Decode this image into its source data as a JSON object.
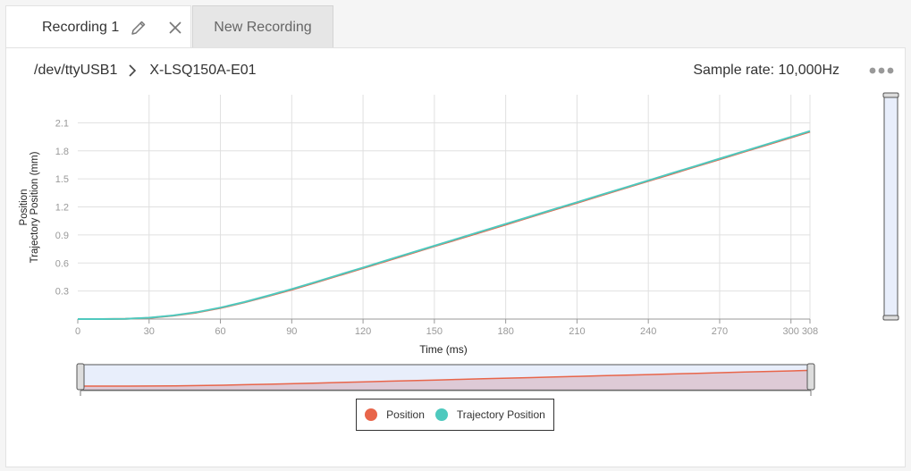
{
  "tabs": [
    {
      "label": "Recording 1",
      "active": true
    },
    {
      "label": "New Recording",
      "active": false
    }
  ],
  "breadcrumb": {
    "port": "/dev/ttyUSB1",
    "device": "X-LSQ150A-E01"
  },
  "sample_rate": "Sample rate: 10,000Hz",
  "colors": {
    "position": "#e8654a",
    "trajectory": "#4ec9be",
    "navigator_fill": "#e8eefb"
  },
  "chart_data": {
    "type": "line",
    "xlabel": "Time (ms)",
    "ylabel_lines": [
      "Position",
      "Trajectory Position (mm)"
    ],
    "xlim": [
      0,
      308
    ],
    "ylim": [
      0,
      2.4
    ],
    "x_ticks": [
      0,
      30,
      60,
      90,
      120,
      150,
      180,
      210,
      240,
      270,
      300,
      308
    ],
    "y_ticks": [
      0.3,
      0.6,
      0.9,
      1.2,
      1.5,
      1.8,
      2.1
    ],
    "x_tick_labels": [
      "0",
      "30",
      "60",
      "90",
      "120",
      "150",
      "180",
      "210",
      "240",
      "270",
      "300",
      "308"
    ],
    "y_tick_labels": [
      "0.3",
      "0.6",
      "0.9",
      "1.2",
      "1.5",
      "1.8",
      "2.1"
    ],
    "grid": true,
    "legend_placement": "bottom-center",
    "series": [
      {
        "name": "Position",
        "x": [
          0,
          10,
          20,
          30,
          40,
          50,
          60,
          70,
          80,
          90,
          100,
          110,
          120,
          130,
          140,
          150,
          160,
          170,
          180,
          190,
          200,
          210,
          220,
          230,
          240,
          250,
          260,
          270,
          280,
          290,
          300,
          308
        ],
        "y": [
          0,
          0,
          0.002,
          0.012,
          0.035,
          0.07,
          0.118,
          0.178,
          0.245,
          0.315,
          0.39,
          0.468,
          0.545,
          0.622,
          0.7,
          0.778,
          0.855,
          0.932,
          1.01,
          1.088,
          1.166,
          1.243,
          1.321,
          1.399,
          1.476,
          1.554,
          1.632,
          1.709,
          1.787,
          1.865,
          1.942,
          2.004
        ]
      },
      {
        "name": "Trajectory Position",
        "x": [
          0,
          10,
          20,
          30,
          40,
          50,
          60,
          70,
          80,
          90,
          100,
          110,
          120,
          130,
          140,
          150,
          160,
          170,
          180,
          190,
          200,
          210,
          220,
          230,
          240,
          250,
          260,
          270,
          280,
          290,
          300,
          308
        ],
        "y": [
          0,
          0,
          0.003,
          0.014,
          0.038,
          0.074,
          0.122,
          0.182,
          0.25,
          0.321,
          0.396,
          0.474,
          0.551,
          0.629,
          0.707,
          0.784,
          0.862,
          0.94,
          1.017,
          1.095,
          1.173,
          1.25,
          1.328,
          1.405,
          1.483,
          1.561,
          1.638,
          1.716,
          1.794,
          1.871,
          1.949,
          2.011
        ]
      }
    ]
  }
}
